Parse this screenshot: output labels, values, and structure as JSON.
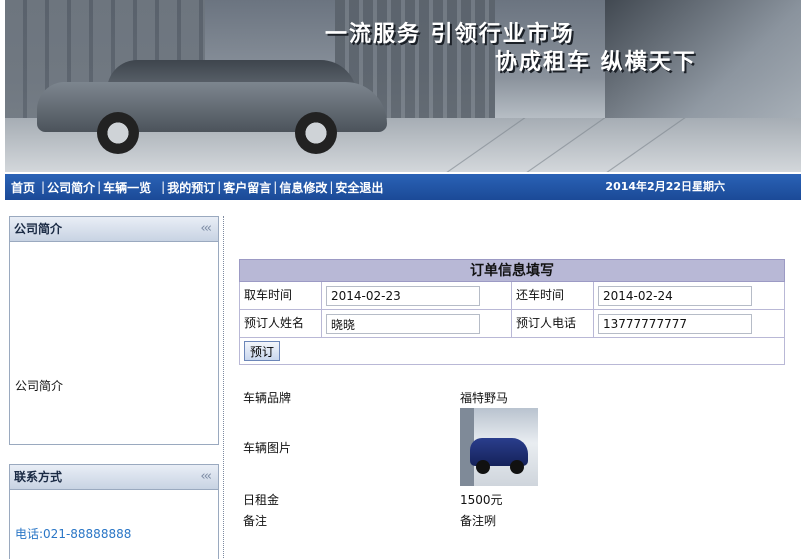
{
  "banner": {
    "slogan_line1": "一流服务 引领行业市场",
    "slogan_line2": "协成租车 纵横天下"
  },
  "nav": {
    "items": [
      "首页",
      "公司简介",
      "车辆一览",
      "我的预订",
      "客户留言",
      "信息修改",
      "安全退出"
    ],
    "separator": "|",
    "date": "2014年2月22日星期六"
  },
  "sidebar": {
    "company_box": {
      "title": "公司简介",
      "chevrons": "‹‹‹",
      "content": "公司简介"
    },
    "contact_box": {
      "title": "联系方式",
      "chevrons": "‹‹‹",
      "phone": "电话:021-88888888"
    }
  },
  "order_form": {
    "title": "订单信息填写",
    "pickup_label": "取车时间",
    "pickup_value": "2014-02-23",
    "return_label": "还车时间",
    "return_value": "2014-02-24",
    "name_label": "预订人姓名",
    "name_value": "晓晓",
    "phone_label": "预订人电话",
    "phone_value": "13777777777",
    "submit_label": "预订"
  },
  "car_details": {
    "brand_label": "车辆品牌",
    "brand_value": "福特野马",
    "image_label": "车辆图片",
    "rent_label": "日租金",
    "rent_value": "1500元",
    "remark_label": "备注",
    "remark_value": "备注咧"
  },
  "colors": {
    "nav_bg": "#1f4f9d",
    "form_title_bg": "#b8b8d6",
    "phone_text": "#2a76c6"
  }
}
